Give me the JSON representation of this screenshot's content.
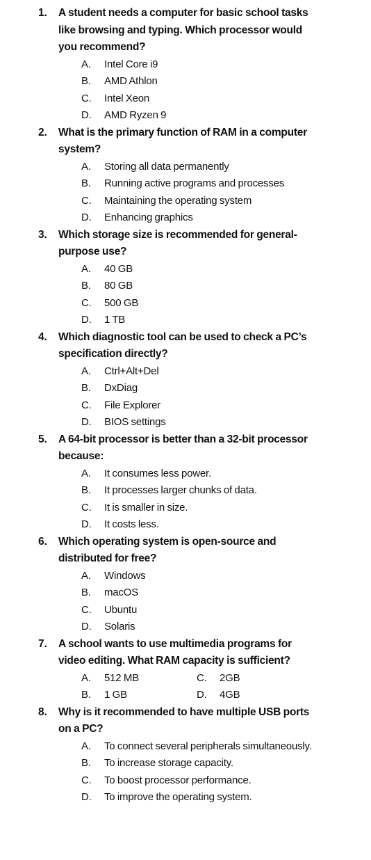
{
  "document": {
    "type": "multiple-choice-quiz-worksheet",
    "text_color": "#111111",
    "background_color": "#ffffff"
  },
  "questions": [
    {
      "number": "1.",
      "text": "A student needs a computer for basic school tasks like browsing and typing. Which processor would you recommend?",
      "layout": "single-column",
      "options": [
        {
          "letter": "A.",
          "text": "Intel Core i9"
        },
        {
          "letter": "B.",
          "text": "AMD Athlon"
        },
        {
          "letter": "C.",
          "text": "Intel Xeon"
        },
        {
          "letter": "D.",
          "text": "AMD Ryzen 9"
        }
      ]
    },
    {
      "number": "2.",
      "text": "What is the primary function of RAM in a computer system?",
      "layout": "single-column",
      "options": [
        {
          "letter": "A.",
          "text": "Storing all data permanently"
        },
        {
          "letter": "B.",
          "text": "Running active programs and processes"
        },
        {
          "letter": "C.",
          "text": "Maintaining the operating system"
        },
        {
          "letter": "D.",
          "text": "Enhancing graphics"
        }
      ]
    },
    {
      "number": "3.",
      "text": "Which storage size is recommended for general-purpose use?",
      "layout": "single-column",
      "options": [
        {
          "letter": "A.",
          "text": "40 GB"
        },
        {
          "letter": "B.",
          "text": "80 GB"
        },
        {
          "letter": "C.",
          "text": "500 GB"
        },
        {
          "letter": "D.",
          "text": "1 TB"
        }
      ]
    },
    {
      "number": "4.",
      "text": "Which diagnostic tool can be used to check a PC’s specification directly?",
      "layout": "single-column",
      "options": [
        {
          "letter": "A.",
          "text": "Ctrl+Alt+Del"
        },
        {
          "letter": "B.",
          "text": "DxDiag"
        },
        {
          "letter": "C.",
          "text": "File Explorer"
        },
        {
          "letter": "D.",
          "text": "BIOS settings"
        }
      ]
    },
    {
      "number": "5.",
      "text": "A 64-bit processor is better than a 32-bit processor because:",
      "layout": "single-column",
      "options": [
        {
          "letter": "A.",
          "text": "It consumes less power."
        },
        {
          "letter": "B.",
          "text": "It processes larger chunks of data."
        },
        {
          "letter": "C.",
          "text": "It is smaller in size."
        },
        {
          "letter": "D.",
          "text": "It costs less."
        }
      ]
    },
    {
      "number": "6.",
      "text": "Which operating system is open-source and distributed for free?",
      "layout": "single-column",
      "options": [
        {
          "letter": "A.",
          "text": "Windows"
        },
        {
          "letter": "B.",
          "text": "macOS"
        },
        {
          "letter": "C.",
          "text": "Ubuntu"
        },
        {
          "letter": "D.",
          "text": "Solaris"
        }
      ]
    },
    {
      "number": "7.",
      "text": "A school wants to use multimedia programs for video editing. What RAM capacity is sufficient?",
      "layout": "two-column",
      "options": [
        {
          "letter": "A.",
          "text": "512 MB"
        },
        {
          "letter": "B.",
          "text": "1 GB"
        },
        {
          "letter": "C.",
          "text": "2GB"
        },
        {
          "letter": "D.",
          "text": "4GB"
        }
      ]
    },
    {
      "number": "8.",
      "text": "Why is it recommended to have multiple USB ports on a PC?",
      "layout": "single-column",
      "options": [
        {
          "letter": "A.",
          "text": "To connect several peripherals simultaneously."
        },
        {
          "letter": "B.",
          "text": "To increase storage capacity."
        },
        {
          "letter": "C.",
          "text": "To boost processor performance."
        },
        {
          "letter": "D.",
          "text": "To improve the operating system."
        }
      ]
    }
  ]
}
